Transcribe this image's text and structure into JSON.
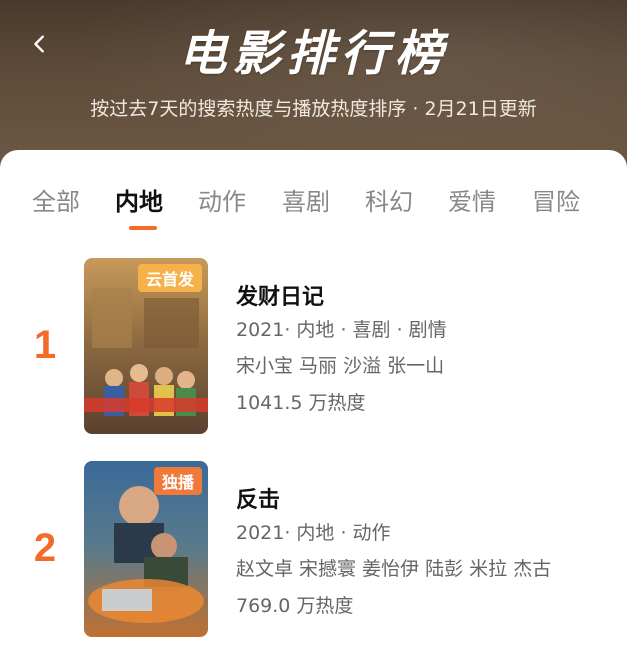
{
  "header": {
    "title": "电影排行榜",
    "subtitle": "按过去7天的搜索热度与播放热度排序 · 2月21日更新"
  },
  "tabs": [
    {
      "label": "全部"
    },
    {
      "label": "内地"
    },
    {
      "label": "动作"
    },
    {
      "label": "喜剧"
    },
    {
      "label": "科幻"
    },
    {
      "label": "爱情"
    },
    {
      "label": "冒险"
    }
  ],
  "active_tab": "内地",
  "movies": [
    {
      "rank": "1",
      "badge": "云首发",
      "title": "发财日记",
      "meta": "2021· 内地 · 喜剧 · 剧情",
      "cast": "宋小宝 马丽 沙溢 张一山",
      "heat": "1041.5 万热度"
    },
    {
      "rank": "2",
      "badge": "独播",
      "title": "反击",
      "meta": "2021· 内地 · 动作",
      "cast": "赵文卓 宋撼寰 姜怡伊 陆彭 米拉 杰古",
      "heat": "769.0 万热度"
    }
  ],
  "colors": {
    "accent": "#f26b2a",
    "header_bg": "#5d4a38"
  }
}
